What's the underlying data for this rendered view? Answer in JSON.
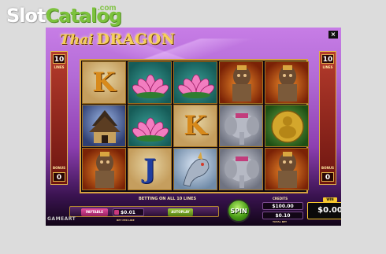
{
  "watermark": {
    "slot": "Slot",
    "catalog": "Catalog",
    "com": ".com"
  },
  "game": {
    "logo_part1": "Thai",
    "logo_part2": "DRAGON",
    "close_label": "×",
    "left_lines_top": "10",
    "right_lines_top": "10",
    "left_bottom": "0",
    "right_bottom": "0",
    "lines_label": "LINES",
    "bonus_label": "BONUS"
  },
  "reels": [
    [
      "K",
      "temple",
      "statue"
    ],
    [
      "lotus",
      "lotus",
      "J"
    ],
    [
      "lotus",
      "K",
      "dragon"
    ],
    [
      "statue",
      "elephant",
      "elephant"
    ],
    [
      "statue",
      "buddha",
      "statue"
    ]
  ],
  "panel": {
    "betting_text": "BETTING ON ALL 10 LINES",
    "paytable": "PAYTABLE",
    "bet_per_line": "$0.01",
    "bet_per_line_label": "BET PER LINE",
    "autoplay": "AUTOPLAY",
    "spin": "SPIN",
    "credits_label": "CREDITS",
    "credits": "$100.00",
    "total_bet": "$0.10",
    "total_bet_label": "TOTAL BET",
    "win_label": "WIN",
    "win": "$0.00"
  },
  "brand": "GAMEART"
}
